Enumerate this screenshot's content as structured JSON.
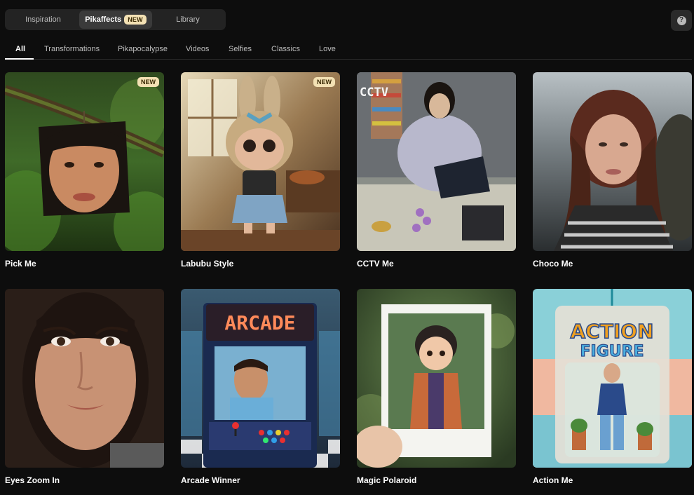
{
  "top_tabs": {
    "items": [
      {
        "label": "Inspiration"
      },
      {
        "label": "Pikaffects",
        "badge": "NEW"
      },
      {
        "label": "Library"
      }
    ],
    "active_index": 1
  },
  "help": {
    "glyph": "?"
  },
  "categories": {
    "items": [
      {
        "label": "All"
      },
      {
        "label": "Transformations"
      },
      {
        "label": "Pikapocalypse"
      },
      {
        "label": "Videos"
      },
      {
        "label": "Selfies"
      },
      {
        "label": "Classics"
      },
      {
        "label": "Love"
      }
    ],
    "active_index": 0
  },
  "cards": [
    {
      "title": "Pick Me",
      "badge": "NEW",
      "icon": "hanging-portrait-jungle"
    },
    {
      "title": "Labubu Style",
      "badge": "NEW",
      "icon": "plush-bunny-toy"
    },
    {
      "title": "CCTV Me",
      "overlay_text": "CCTV",
      "icon": "security-camera-still"
    },
    {
      "title": "Choco Me",
      "icon": "woman-portrait-seaside"
    },
    {
      "title": "Eyes Zoom In",
      "icon": "woman-closeup-portrait"
    },
    {
      "title": "Arcade Winner",
      "overlay_text": "ARCADE",
      "icon": "arcade-cabinet"
    },
    {
      "title": "Magic Polaroid",
      "icon": "polaroid-photo"
    },
    {
      "title": "Action Me",
      "overlay_text_line1": "ACTION",
      "overlay_text_line2": "FIGURE",
      "icon": "action-figure-package"
    }
  ],
  "colors": {
    "background": "#0d0d0d",
    "badge": "#f3e1b4",
    "tab_bg": "#232323",
    "tab_active": "#3a3a3a"
  }
}
